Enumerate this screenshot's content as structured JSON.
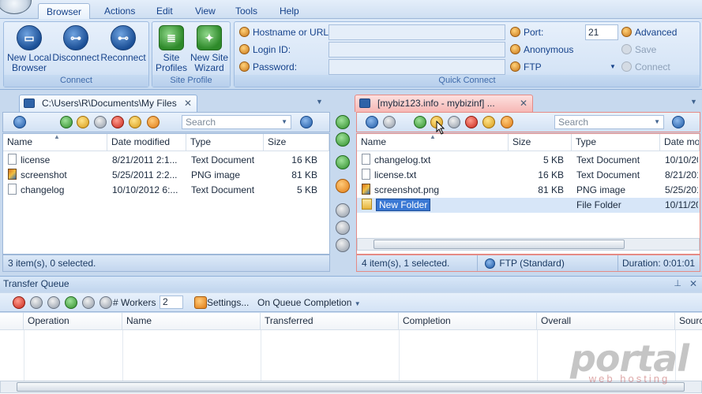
{
  "ribbon": {
    "tabs": [
      "Browser",
      "Actions",
      "Edit",
      "View",
      "Tools",
      "Help"
    ],
    "groups": {
      "connect": {
        "caption": "Connect",
        "buttons": [
          {
            "line1": "New Local",
            "line2": "Browser"
          },
          {
            "line1": "Disconnect",
            "line2": ""
          },
          {
            "line1": "Reconnect",
            "line2": ""
          }
        ]
      },
      "site_profile": {
        "caption": "Site Profile",
        "buttons": [
          {
            "line1": "Site",
            "line2": "Profiles"
          },
          {
            "line1": "New Site",
            "line2": "Wizard"
          }
        ]
      },
      "quick_connect": {
        "caption": "Quick Connect",
        "hostname_label": "Hostname or URL:",
        "hostname_value": "",
        "login_label": "Login ID:",
        "login_value": "",
        "password_label": "Password:",
        "password_value": "",
        "port_label": "Port:",
        "port_value": "21",
        "anonymous_label": "Anonymous",
        "protocol_value": "FTP",
        "advanced_label": "Advanced",
        "save_label": "Save",
        "connect_label": "Connect"
      }
    }
  },
  "local_pane": {
    "tab_title": "C:\\Users\\R\\Documents\\My Files",
    "search_placeholder": "Search",
    "columns": [
      "Name",
      "Date modified",
      "Type",
      "Size"
    ],
    "files": [
      {
        "name": "license",
        "date": "8/21/2011 2:1...",
        "type": "Text Document",
        "size": "16 KB",
        "icon": "text-file-icon"
      },
      {
        "name": "screenshot",
        "date": "5/25/2011 2:2...",
        "type": "PNG image",
        "size": "81 KB",
        "icon": "png-file-icon"
      },
      {
        "name": "changelog",
        "date": "10/10/2012 6:...",
        "type": "Text Document",
        "size": "5 KB",
        "icon": "text-file-icon"
      }
    ],
    "status": "3 item(s), 0 selected."
  },
  "remote_pane": {
    "tab_title": "[mybiz123.info - mybizinf] ...",
    "search_placeholder": "Search",
    "columns": [
      "Name",
      "Size",
      "Type",
      "Date mo"
    ],
    "files": [
      {
        "name": "changelog.txt",
        "size": "5 KB",
        "type": "Text Document",
        "date": "10/10/20",
        "icon": "text-file-icon"
      },
      {
        "name": "license.txt",
        "size": "16 KB",
        "type": "Text Document",
        "date": "8/21/201",
        "icon": "text-file-icon"
      },
      {
        "name": "screenshot.png",
        "size": "81 KB",
        "type": "PNG image",
        "date": "5/25/201",
        "icon": "png-file-icon"
      },
      {
        "name": "New Folder",
        "size": "",
        "type": "File Folder",
        "date": "10/11/20",
        "icon": "folder-icon"
      }
    ],
    "status_items": "4 item(s), 1 selected.",
    "status_protocol": "FTP (Standard)",
    "status_duration": "Duration: 0:01:01"
  },
  "queue": {
    "title": "Transfer Queue",
    "workers_label": "# Workers",
    "workers_value": "2",
    "settings_label": "Settings...",
    "completion_label": "On Queue Completion",
    "columns": [
      "Operation",
      "Name",
      "Transferred",
      "Completion",
      "Overall",
      "Sourc"
    ]
  },
  "watermark": {
    "main": "portal",
    "sub": "web hosting"
  }
}
